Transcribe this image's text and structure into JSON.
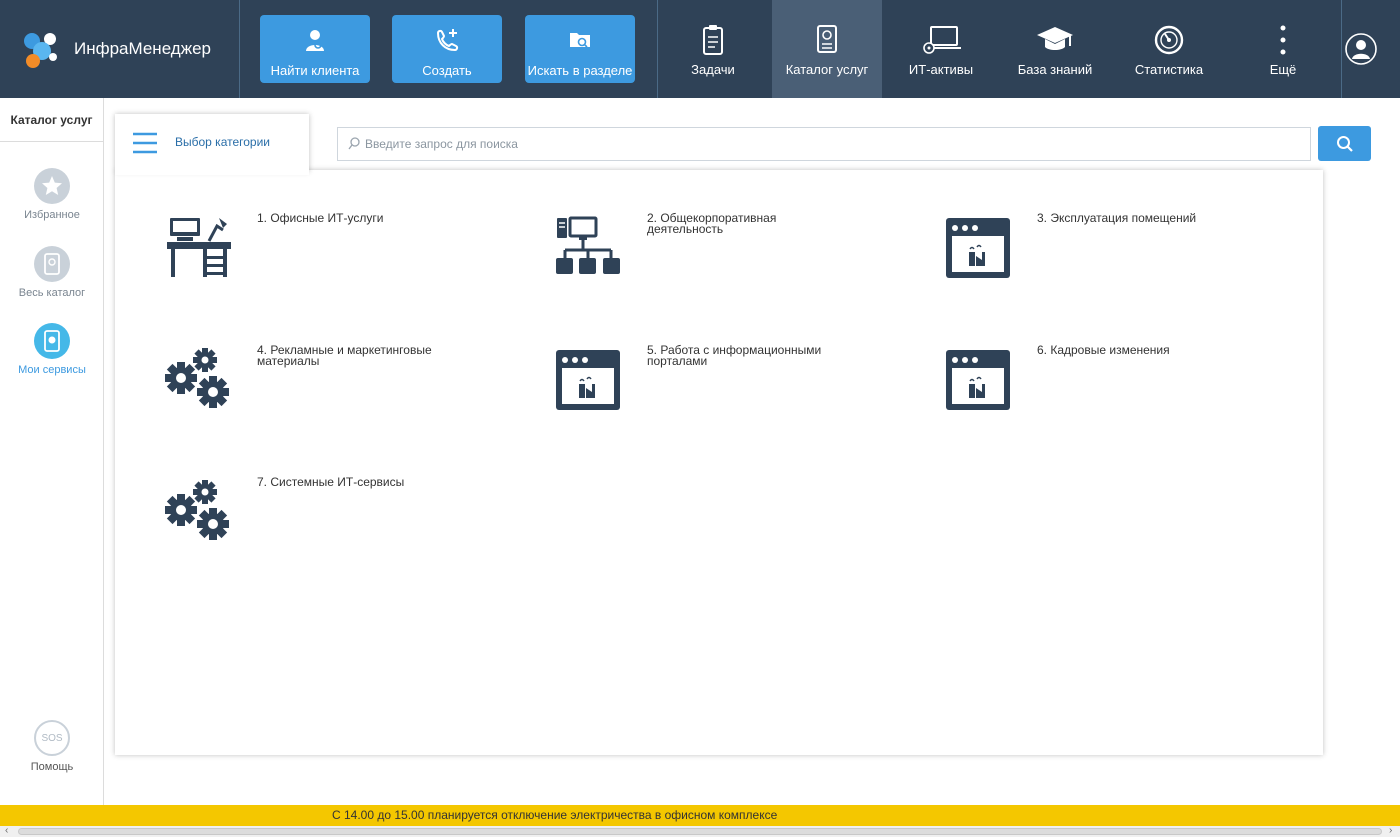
{
  "app": {
    "title": "ИнфраМенеджер"
  },
  "actions": [
    {
      "label": "Найти клиента",
      "icon": "person-search-icon"
    },
    {
      "label": "Создать",
      "icon": "phone-plus-icon"
    },
    {
      "label": "Искать в разделе",
      "icon": "folder-search-icon"
    }
  ],
  "nav": [
    {
      "label": "Задачи",
      "icon": "clipboard-icon",
      "active": false
    },
    {
      "label": "Каталог услуг",
      "icon": "catalog-book-icon",
      "active": true
    },
    {
      "label": "ИТ-активы",
      "icon": "laptop-icon",
      "active": false
    },
    {
      "label": "База знаний",
      "icon": "graduation-cap-icon",
      "active": false
    },
    {
      "label": "Статистика",
      "icon": "gauge-icon",
      "active": false
    },
    {
      "label": "Ещё",
      "icon": "more-vertical-icon",
      "active": false
    }
  ],
  "sidebar": {
    "title": "Каталог услуг",
    "items": [
      {
        "label": "Избранное",
        "icon": "star-icon",
        "active": false
      },
      {
        "label": "Весь каталог",
        "icon": "book-icon",
        "active": false
      },
      {
        "label": "Мои сервисы",
        "icon": "my-services-icon",
        "active": true
      }
    ],
    "help": {
      "label": "Помощь",
      "icon_text": "SOS"
    }
  },
  "category_selector": {
    "label": "Выбор категории"
  },
  "search": {
    "placeholder": "Введите запрос для поиска",
    "value": ""
  },
  "categories": [
    {
      "label": "1. Офисные ИТ-услуги",
      "icon": "office-desk-icon"
    },
    {
      "label": "2. Общекорпоративная деятельность",
      "icon": "network-icon"
    },
    {
      "label": "3. Эксплуатация помещений",
      "icon": "factory-window-icon"
    },
    {
      "label": "4. Рекламные и маркетинговые материалы",
      "icon": "gears-icon"
    },
    {
      "label": "5. Работа с информационными порталами",
      "icon": "factory-window-icon"
    },
    {
      "label": "6. Кадровые изменения",
      "icon": "factory-window-icon"
    },
    {
      "label": "7. Системные ИТ-сервисы",
      "icon": "gears-icon"
    }
  ],
  "ticker": {
    "text": "С 14.00 до 15.00 планируется отключение электричества в офисном комплексе"
  },
  "colors": {
    "topbar": "#2f4257",
    "accent": "#3d9ae0",
    "ticker": "#f4c700",
    "icon_dark": "#2f4257"
  }
}
